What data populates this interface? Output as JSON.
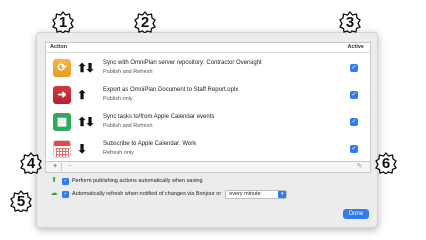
{
  "table": {
    "header_action": "Action",
    "header_active": "Active",
    "rows": [
      {
        "title": "Sync with OmniPlan server repository: Contractor Oversight",
        "subtitle": "Publish and Refresh",
        "arrows": "⬆⬇",
        "checked": true
      },
      {
        "title": "Export as OmniPlan Document to Staff Report.oplx",
        "subtitle": "Publish only",
        "arrows": "⬆",
        "checked": true
      },
      {
        "title": "Sync tasks to/from Apple Calendar events",
        "subtitle": "Publish and Refresh",
        "arrows": "⬆⬇",
        "checked": true
      },
      {
        "title": "Subscribe to Apple Calendar: Work",
        "subtitle": "Refresh only",
        "arrows": "⬇",
        "checked": true
      }
    ]
  },
  "toolbar": {
    "add": "+",
    "remove": "−",
    "edit": "✎"
  },
  "options": {
    "auto_publish_label": "Perform publishing actions automatically when saving",
    "auto_refresh_label": "Automatically refresh when notified of changes via Bonjour or",
    "refresh_interval": "every minute"
  },
  "done_label": "Done",
  "callouts": [
    "1",
    "2",
    "3",
    "4",
    "5",
    "6"
  ],
  "icons": {
    "row1": "omniplan-sync-icon",
    "row2": "export-document-icon",
    "row3": "calendar-sync-icon",
    "row4": "calendar-subscribe-icon"
  }
}
